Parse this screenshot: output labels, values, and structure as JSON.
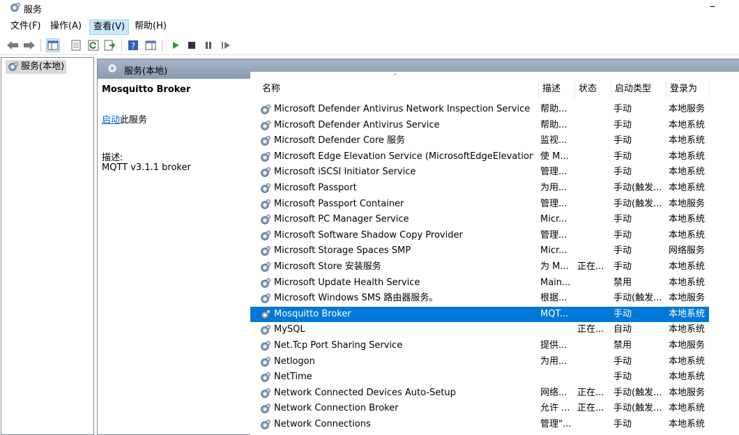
{
  "window": {
    "title": "服务",
    "minimize_label": "–"
  },
  "menu": [
    {
      "label": "文件(F)"
    },
    {
      "label": "操作(A)"
    },
    {
      "label": "查看(V)"
    },
    {
      "label": "帮助(H)"
    }
  ],
  "tree": {
    "root_label": "服务(本地)"
  },
  "pane": {
    "header_label": "服务(本地)",
    "selected_name": "Mosquitto Broker",
    "start_link": "启动",
    "start_suffix": "此服务",
    "desc_label": "描述:",
    "desc_text": "MQTT v3.1.1 broker"
  },
  "columns": {
    "name": "名称",
    "desc": "描述",
    "status": "状态",
    "starttype": "启动类型",
    "logon": "登录为"
  },
  "rows": [
    {
      "name": "Microsoft Defender Antivirus Network Inspection Service",
      "desc": "帮助...",
      "status": "",
      "starttype": "手动",
      "logon": "本地服务"
    },
    {
      "name": "Microsoft Defender Antivirus Service",
      "desc": "帮助...",
      "status": "",
      "starttype": "手动",
      "logon": "本地系统"
    },
    {
      "name": "Microsoft Defender Core 服务",
      "desc": "监视...",
      "status": "",
      "starttype": "手动",
      "logon": "本地系统"
    },
    {
      "name": "Microsoft Edge Elevation Service (MicrosoftEdgeElevationServi...",
      "desc": "使 M...",
      "status": "",
      "starttype": "手动",
      "logon": "本地系统"
    },
    {
      "name": "Microsoft iSCSI Initiator Service",
      "desc": "管理...",
      "status": "",
      "starttype": "手动",
      "logon": "本地系统"
    },
    {
      "name": "Microsoft Passport",
      "desc": "为用...",
      "status": "",
      "starttype": "手动(触发...",
      "logon": "本地系统"
    },
    {
      "name": "Microsoft Passport Container",
      "desc": "管理...",
      "status": "",
      "starttype": "手动(触发...",
      "logon": "本地服务"
    },
    {
      "name": "Microsoft PC Manager Service",
      "desc": "Micr...",
      "status": "",
      "starttype": "手动",
      "logon": "本地系统"
    },
    {
      "name": "Microsoft Software Shadow Copy Provider",
      "desc": "管理...",
      "status": "",
      "starttype": "手动",
      "logon": "本地系统"
    },
    {
      "name": "Microsoft Storage Spaces SMP",
      "desc": "Micr...",
      "status": "",
      "starttype": "手动",
      "logon": "网络服务"
    },
    {
      "name": "Microsoft Store 安装服务",
      "desc": "为 M...",
      "status": "正在...",
      "starttype": "手动",
      "logon": "本地系统"
    },
    {
      "name": "Microsoft Update Health Service",
      "desc": "Main...",
      "status": "",
      "starttype": "禁用",
      "logon": "本地系统"
    },
    {
      "name": "Microsoft Windows SMS 路由器服务。",
      "desc": "根据...",
      "status": "",
      "starttype": "手动(触发...",
      "logon": "本地服务"
    },
    {
      "name": "Mosquitto Broker",
      "desc": "MQT...",
      "status": "",
      "starttype": "手动",
      "logon": "本地系统",
      "selected": true
    },
    {
      "name": "MySQL",
      "desc": "",
      "status": "正在...",
      "starttype": "自动",
      "logon": "本地系统"
    },
    {
      "name": "Net.Tcp Port Sharing Service",
      "desc": "提供...",
      "status": "",
      "starttype": "禁用",
      "logon": "本地服务"
    },
    {
      "name": "Netlogon",
      "desc": "为用...",
      "status": "",
      "starttype": "手动",
      "logon": "本地系统"
    },
    {
      "name": "NetTime",
      "desc": "",
      "status": "",
      "starttype": "手动",
      "logon": "本地系统"
    },
    {
      "name": "Network Connected Devices Auto-Setup",
      "desc": "网络...",
      "status": "正在...",
      "starttype": "手动(触发...",
      "logon": "本地服务"
    },
    {
      "name": "Network Connection Broker",
      "desc": "允许 ...",
      "status": "正在...",
      "starttype": "手动(触发...",
      "logon": "本地系统"
    },
    {
      "name": "Network Connections",
      "desc": "管理\"...",
      "status": "",
      "starttype": "手动",
      "logon": "本地系统"
    }
  ],
  "colors": {
    "selection": "#0078d7",
    "header_band": "#98a9bd",
    "link": "#0066cc"
  }
}
